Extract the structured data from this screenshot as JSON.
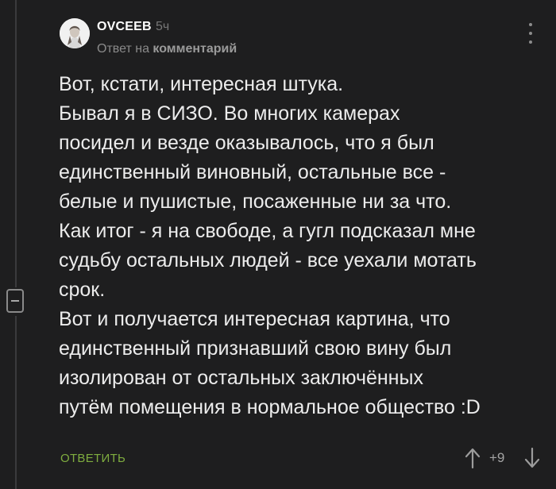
{
  "comment": {
    "author": "OVCEEB",
    "timestamp": "5ч",
    "reply_prefix": "Ответ на",
    "reply_target": "комментарий",
    "body_lines": [
      "Вот, кстати, интересная штука.",
      "Бывал я в СИЗО. Во многих камерах",
      "посидел и везде оказывалось, что я был",
      "единственный виновный, остальные все -",
      "белые и пушистые, посаженные ни за что.",
      "Как итог - я на свободе, а гугл подсказал мне",
      "судьбу остальных людей - все уехали мотать",
      "срок.",
      "Вот и получается интересная картина, что",
      "единственный признавший свою вину был",
      "изолирован от остальных заключённых",
      "путём помещения в нормальное общество :D"
    ],
    "reply_label": "ОТВЕТИТЬ",
    "score": "+9"
  },
  "icons": {
    "avatar": "avatar-photo",
    "more": "more-vertical-icon",
    "collapse": "collapse-minus-icon",
    "upvote": "arrow-up-icon",
    "downvote": "arrow-down-icon"
  },
  "colors": {
    "background": "#1e1e1f",
    "text": "#ececec",
    "muted": "#8a8a8a",
    "accent_green": "#7fad3f"
  }
}
